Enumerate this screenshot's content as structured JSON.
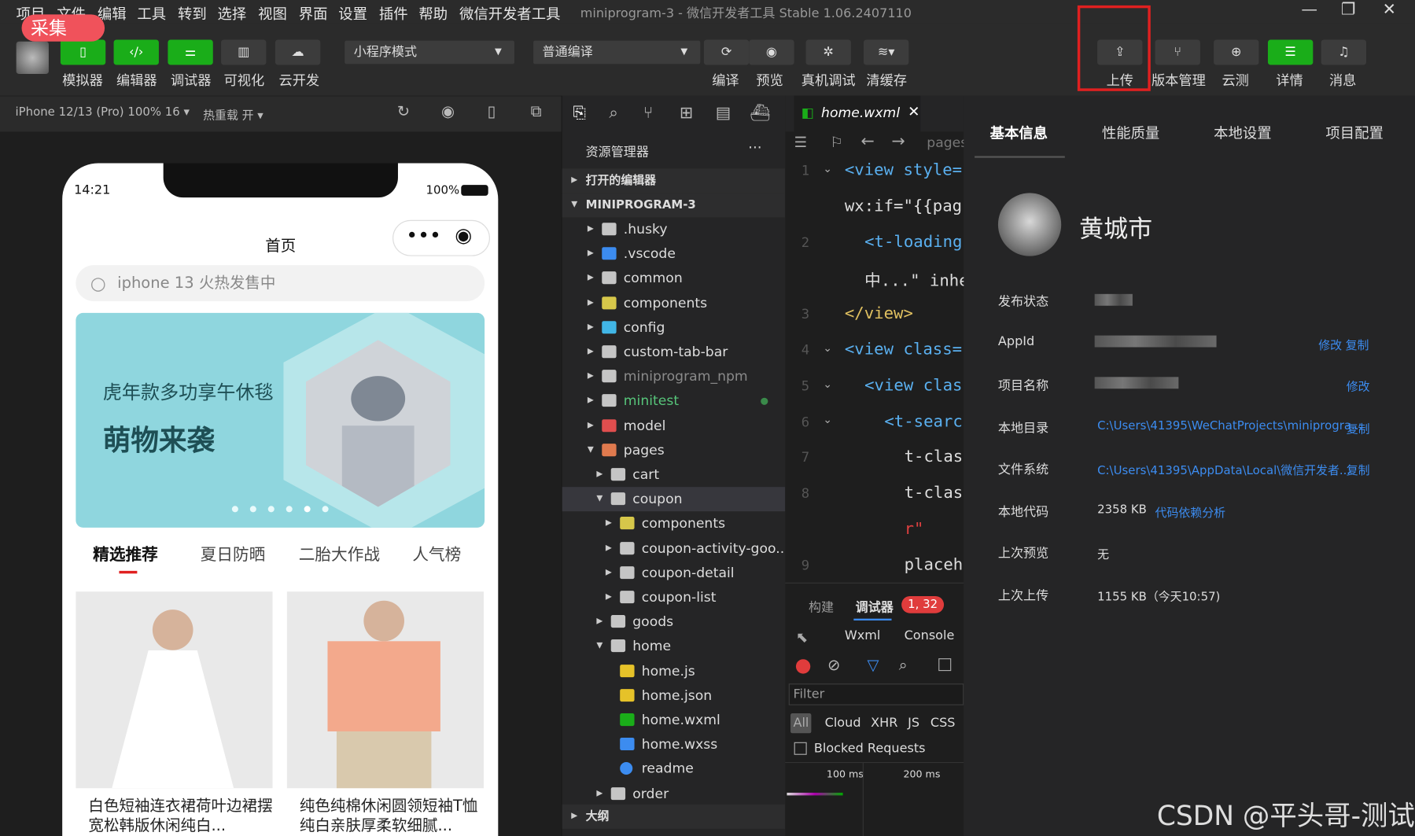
{
  "menu": [
    "项目",
    "文件",
    "编辑",
    "工具",
    "转到",
    "选择",
    "视图",
    "界面",
    "设置",
    "插件",
    "帮助",
    "微信开发者工具"
  ],
  "window_title": "miniprogram-3 - 微信开发者工具 Stable 1.06.2407110",
  "collect_badge": "采集",
  "toolbar": {
    "simulator": "模拟器",
    "editor": "编辑器",
    "debugger": "调试器",
    "visual": "可视化",
    "cloud": "云开发",
    "mode_select": "小程序模式",
    "compile_select": "普通编译",
    "compile": "编译",
    "preview": "预览",
    "real_debug": "真机调试",
    "clear_cache": "清缓存",
    "upload": "上传",
    "version": "版本管理",
    "cloud_test": "云测",
    "details": "详情",
    "messages": "消息"
  },
  "sim_bar": {
    "device": "iPhone 12/13 (Pro) 100% 16 ▾",
    "hot_reload": "热重载 开 ▾"
  },
  "phone": {
    "time": "14:21",
    "battery": "100%",
    "page_title": "首页",
    "search_placeholder": "iphone 13 火热发售中",
    "banner_line1": "虎年款多功享午休毯",
    "banner_line2": "萌物来袭",
    "tabs": [
      "精选推荐",
      "夏日防晒",
      "二胎大作战",
      "人气榜"
    ],
    "products": [
      {
        "title": "白色短袖连衣裙荷叶边裙摆宽松韩版休闲纯白..."
      },
      {
        "title": "纯色纯棉休闲圆领短袖T恤纯白亲肤厚柔软细腻..."
      }
    ]
  },
  "explorer": {
    "title": "资源管理器",
    "more": "···",
    "open_editors": "打开的编辑器",
    "project": "MINIPROGRAM-3",
    "tree": [
      {
        "name": ".husky",
        "depth": 0,
        "open": false,
        "type": "folder"
      },
      {
        "name": ".vscode",
        "depth": 0,
        "open": false,
        "type": "vscode"
      },
      {
        "name": "common",
        "depth": 0,
        "open": false,
        "type": "folder"
      },
      {
        "name": "components",
        "depth": 0,
        "open": false,
        "type": "components"
      },
      {
        "name": "config",
        "depth": 0,
        "open": false,
        "type": "config"
      },
      {
        "name": "custom-tab-bar",
        "depth": 0,
        "open": false,
        "type": "folder"
      },
      {
        "name": "miniprogram_npm",
        "depth": 0,
        "open": false,
        "type": "folder"
      },
      {
        "name": "minitest",
        "depth": 0,
        "open": false,
        "type": "folder"
      },
      {
        "name": "model",
        "depth": 0,
        "open": false,
        "type": "model"
      },
      {
        "name": "pages",
        "depth": 0,
        "open": true,
        "type": "pages"
      },
      {
        "name": "cart",
        "depth": 1,
        "open": false,
        "type": "folder"
      },
      {
        "name": "coupon",
        "depth": 1,
        "open": true,
        "type": "folder"
      },
      {
        "name": "components",
        "depth": 2,
        "open": false,
        "type": "components"
      },
      {
        "name": "coupon-activity-goo...",
        "depth": 2,
        "open": false,
        "type": "folder"
      },
      {
        "name": "coupon-detail",
        "depth": 2,
        "open": false,
        "type": "folder"
      },
      {
        "name": "coupon-list",
        "depth": 2,
        "open": false,
        "type": "folder"
      },
      {
        "name": "goods",
        "depth": 1,
        "open": false,
        "type": "folder"
      },
      {
        "name": "home",
        "depth": 1,
        "open": true,
        "type": "folder"
      },
      {
        "name": "home.js",
        "depth": 2,
        "open": null,
        "type": "js"
      },
      {
        "name": "home.json",
        "depth": 2,
        "open": null,
        "type": "json"
      },
      {
        "name": "home.wxml",
        "depth": 2,
        "open": null,
        "type": "wxml"
      },
      {
        "name": "home.wxss",
        "depth": 2,
        "open": null,
        "type": "wxss"
      },
      {
        "name": "readme",
        "depth": 2,
        "open": null,
        "type": "info"
      },
      {
        "name": "order",
        "depth": 1,
        "open": false,
        "type": "folder"
      }
    ],
    "outline": "大纲"
  },
  "editor": {
    "tab": "home.wxml",
    "breadcrumb": "pages",
    "lines": [
      {
        "no": "1",
        "code": "<view style="
      },
      {
        "no": "",
        "code": "wx:if=\"{{pag"
      },
      {
        "no": "2",
        "code": "<t-loading"
      },
      {
        "no": "",
        "code": "中...\" inhe"
      },
      {
        "no": "3",
        "code": "</view>"
      },
      {
        "no": "4",
        "code": "<view class="
      },
      {
        "no": "5",
        "code": "<view clas"
      },
      {
        "no": "6",
        "code": "<t-searc"
      },
      {
        "no": "7",
        "code": "t-clas"
      },
      {
        "no": "8",
        "code": "t-clas"
      },
      {
        "no": "",
        "code": "r\""
      },
      {
        "no": "9",
        "code": "placeh"
      }
    ]
  },
  "debug": {
    "tab_build": "构建",
    "tab_debugger": "调试器",
    "badge": "1, 32",
    "wxml": "Wxml",
    "console": "Console",
    "filter_placeholder": "Filter",
    "types": [
      "All",
      "Cloud",
      "XHR",
      "JS",
      "CSS"
    ],
    "blocked": "Blocked Requests",
    "timeline": [
      "100 ms",
      "200 ms"
    ]
  },
  "details": {
    "tabs": [
      "基本信息",
      "性能质量",
      "本地设置",
      "项目配置"
    ],
    "user": "黄城市",
    "rows": [
      {
        "label": "发布状态",
        "value": "",
        "links": []
      },
      {
        "label": "AppId",
        "value": "",
        "links": [
          "修改",
          "复制"
        ]
      },
      {
        "label": "项目名称",
        "value": "",
        "links": [
          "修改"
        ]
      },
      {
        "label": "本地目录",
        "value": "C:\\Users\\41395\\WeChatProjects\\miniprogra...",
        "links": [
          "复制"
        ]
      },
      {
        "label": "文件系统",
        "value": "C:\\Users\\41395\\AppData\\Local\\微信开发者...",
        "links": [
          "复制"
        ]
      },
      {
        "label": "本地代码",
        "value": "2358 KB",
        "links": [
          "代码依赖分析"
        ]
      },
      {
        "label": "上次预览",
        "value": "无",
        "links": []
      },
      {
        "label": "上次上传",
        "value": "1155 KB（今天10:57)",
        "links": []
      }
    ]
  },
  "watermark": "CSDN @平头哥-测试"
}
